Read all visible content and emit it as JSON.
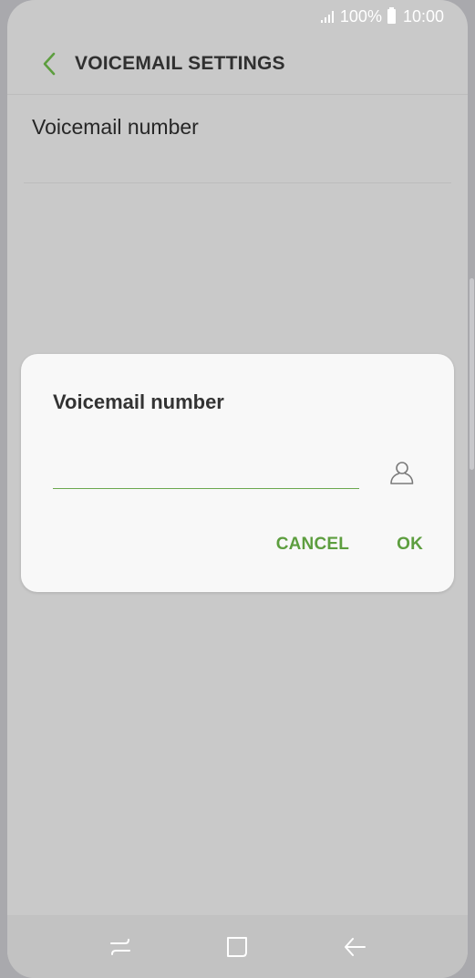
{
  "status_bar": {
    "battery": "100%",
    "time": "10:00"
  },
  "header": {
    "title": "VOICEMAIL SETTINGS"
  },
  "list": {
    "voicemail_number_label": "Voicemail number"
  },
  "dialog": {
    "title": "Voicemail number",
    "input_value": "",
    "cancel_label": "CANCEL",
    "ok_label": "OK"
  },
  "colors": {
    "accent": "#5d9e3f",
    "dim_background": "#c9c9c9",
    "dialog_background": "#f8f8f8"
  },
  "icons": {
    "back": "chevron-left-icon",
    "contact": "person-icon",
    "recent_apps": "recent-apps-icon",
    "home": "home-icon",
    "back_nav": "arrow-left-icon"
  }
}
